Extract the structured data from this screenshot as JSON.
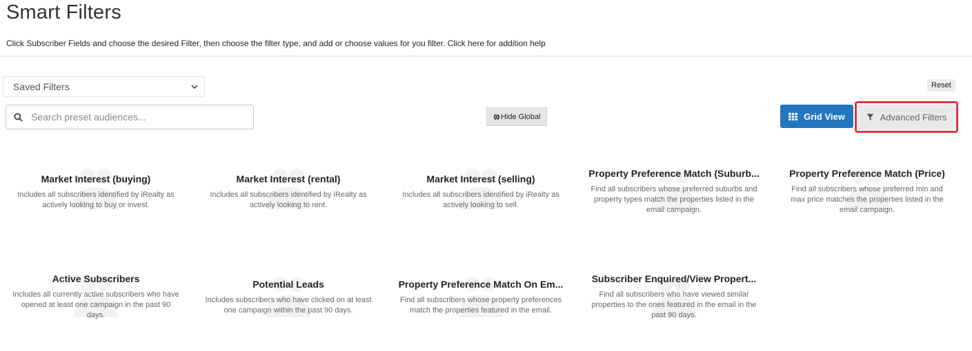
{
  "page": {
    "title": "Smart Filters",
    "subtitle": "Click Subscriber Fields and choose the desired Filter, then choose the filter type, and add or choose values for you filter. Click here for addition help"
  },
  "controls": {
    "saved_filters": "Saved Filters",
    "reset": "Reset",
    "search_placeholder": "Search preset audiences...",
    "hide_global": "Hide Global",
    "grid_view": "Grid View",
    "advanced_filters": "Advanced Filters"
  },
  "colors": {
    "primary": "#2276bf",
    "highlight": "#d9373c"
  },
  "cards": [
    {
      "title": "Market Interest (buying)",
      "desc": "Includes all subscribers identified by iRealty as actively looking to buy or invest."
    },
    {
      "title": "Market Interest (rental)",
      "desc": "Includes all subscribers identified by iRealty as actively looking to rent."
    },
    {
      "title": "Market Interest (selling)",
      "desc": "Includes all subscribers identified by iRealty as actively looking to sell."
    },
    {
      "title": "Property Preference Match (Suburb...",
      "desc": "Find all subscribers whose preferred suburbs and property types match the properties listed in the email campaign."
    },
    {
      "title": "Property Preference Match (Price)",
      "desc": "Find all subscribers whose preferred min and max price matches the properties listed in the email campaign."
    },
    {
      "title": "Active Subscribers",
      "desc": "Includes all currently active subscribers who have opened at least one campaign in the past 90 days."
    },
    {
      "title": "Potential Leads",
      "desc": "Includes subscribers who have clicked on at least one campaign within the past 90 days."
    },
    {
      "title": "Property Preference Match On Em...",
      "desc": "Find all subscribers whose property preferences match the properties featured in the email."
    },
    {
      "title": "Subscriber Enquired/View Propert...",
      "desc": "Find all subscribers who have viewed similar properties to the ones featured in the email in the past 90 days."
    }
  ]
}
